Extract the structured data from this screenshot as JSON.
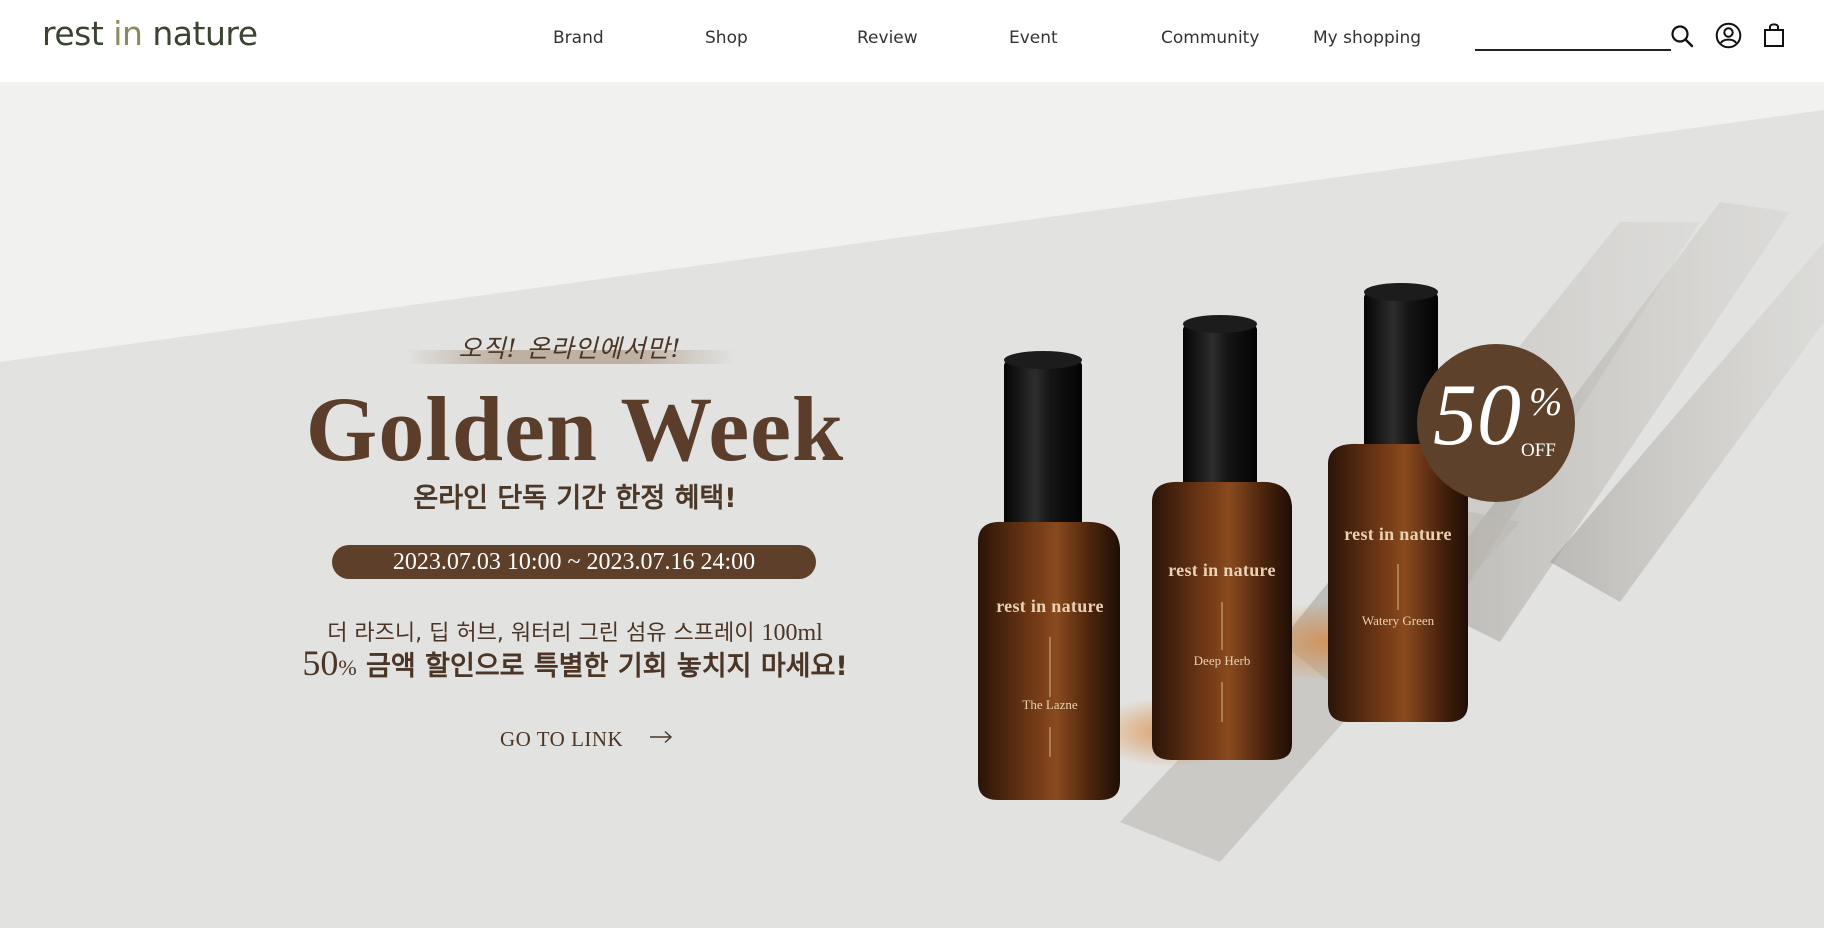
{
  "brand": {
    "logo_main": "rest ",
    "logo_in": "in",
    "logo_end": " nature"
  },
  "nav": {
    "items": [
      {
        "label": "Brand"
      },
      {
        "label": "Shop"
      },
      {
        "label": "Review"
      },
      {
        "label": "Event"
      },
      {
        "label": "Community"
      },
      {
        "label": "My shopping"
      }
    ]
  },
  "header_icons": [
    "search-icon",
    "user-icon",
    "shopping-bag-icon"
  ],
  "search": {
    "value": "",
    "placeholder": ""
  },
  "hero": {
    "tagline": "오직! 온라인에서만!",
    "title": "Golden Week",
    "subtitle": "온라인 단독 기간 한정 혜택!",
    "date_range": "2023.07.03 10:00  ~  2023.07.16 24:00",
    "desc_line1_text": "더 라즈니, 딥 허브, 워터리 그린 섬유 스프레이 ",
    "desc_line1_size": "100ml",
    "desc_line2_num": "50",
    "desc_line2_pct": "%",
    "desc_line2_text": " 금액 할인으로 특별한 기회 놓치지 마세요!",
    "cta_label": "GO TO LINK",
    "badge": {
      "number": "50",
      "percent": "%",
      "off": "OFF"
    }
  },
  "products": [
    {
      "brand": "rest in nature",
      "scent": "The Lazne"
    },
    {
      "brand": "rest in nature",
      "scent": "Deep Herb"
    },
    {
      "brand": "rest in nature",
      "scent": "Watery Green"
    }
  ],
  "colors": {
    "accent_brown": "#5d3f2a",
    "logo_green": "#3a4431",
    "logo_olive": "#8b8a5a",
    "hero_background": "#e4e4e2"
  }
}
